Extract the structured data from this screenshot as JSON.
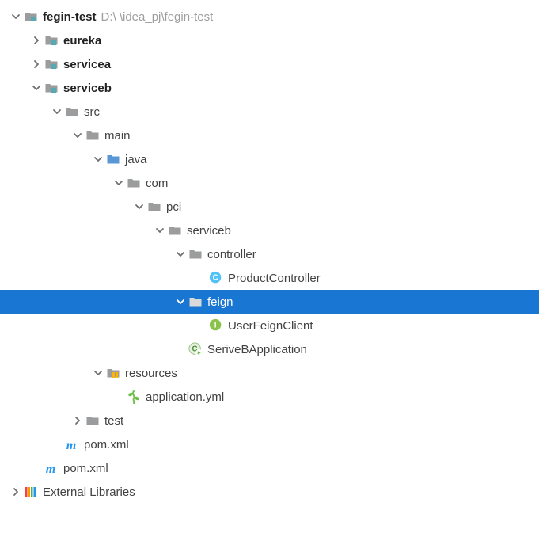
{
  "colors": {
    "selection": "#1976d2",
    "folder_gray": "#9a9c9e",
    "folder_teal": "#59a7b0",
    "folder_source": "#5a96d6",
    "folder_package": "#9a9c9e",
    "class_c": "#4caf50",
    "interface_i": "#8bc34a",
    "spring_run": "#6fbf4a",
    "yml_leaf": "#6fbf4a",
    "maven_m": "#2196f3",
    "lib_bars": [
      "#f44336",
      "#ff9800",
      "#4caf50",
      "#2196f3"
    ]
  },
  "tree": [
    {
      "id": "root",
      "depth": 0,
      "arrow": "down",
      "icon": "module-folder",
      "label": "fegin-test",
      "bold": true,
      "suffix": "D:\\  \\idea_pj\\fegin-test",
      "selected": false
    },
    {
      "id": "eureka",
      "depth": 1,
      "arrow": "right",
      "icon": "module-folder",
      "label": "eureka",
      "bold": true,
      "selected": false
    },
    {
      "id": "servicea",
      "depth": 1,
      "arrow": "right",
      "icon": "module-folder",
      "label": "servicea",
      "bold": true,
      "selected": false
    },
    {
      "id": "serviceb",
      "depth": 1,
      "arrow": "down",
      "icon": "module-folder",
      "label": "serviceb",
      "bold": true,
      "selected": false
    },
    {
      "id": "src",
      "depth": 2,
      "arrow": "down",
      "icon": "folder",
      "label": "src",
      "bold": false,
      "selected": false
    },
    {
      "id": "main",
      "depth": 3,
      "arrow": "down",
      "icon": "folder",
      "label": "main",
      "bold": false,
      "selected": false
    },
    {
      "id": "java",
      "depth": 4,
      "arrow": "down",
      "icon": "source-folder",
      "label": "java",
      "bold": false,
      "selected": false
    },
    {
      "id": "com",
      "depth": 5,
      "arrow": "down",
      "icon": "package-folder",
      "label": "com",
      "bold": false,
      "selected": false
    },
    {
      "id": "pci",
      "depth": 6,
      "arrow": "down",
      "icon": "package-folder",
      "label": "pci",
      "bold": false,
      "selected": false
    },
    {
      "id": "pkg-serviceb",
      "depth": 7,
      "arrow": "down",
      "icon": "package-folder",
      "label": "serviceb",
      "bold": false,
      "selected": false
    },
    {
      "id": "controller",
      "depth": 8,
      "arrow": "down",
      "icon": "package-folder",
      "label": "controller",
      "bold": false,
      "selected": false
    },
    {
      "id": "product-controller",
      "depth": 9,
      "arrow": "none",
      "icon": "class-c",
      "label": "ProductController",
      "bold": false,
      "selected": false
    },
    {
      "id": "feign",
      "depth": 8,
      "arrow": "down",
      "icon": "package-folder",
      "label": "feign",
      "bold": false,
      "selected": true
    },
    {
      "id": "user-feign-client",
      "depth": 9,
      "arrow": "none",
      "icon": "interface-i",
      "label": "UserFeignClient",
      "bold": false,
      "selected": false
    },
    {
      "id": "serviceb-app",
      "depth": 8,
      "arrow": "none",
      "icon": "spring-runnable",
      "label": "SeriveBApplication",
      "bold": false,
      "selected": false
    },
    {
      "id": "resources",
      "depth": 4,
      "arrow": "down",
      "icon": "resources-folder",
      "label": "resources",
      "bold": false,
      "selected": false
    },
    {
      "id": "application-yml",
      "depth": 5,
      "arrow": "none",
      "icon": "yml-file",
      "label": "application.yml",
      "bold": false,
      "selected": false
    },
    {
      "id": "test",
      "depth": 3,
      "arrow": "right",
      "icon": "folder",
      "label": "test",
      "bold": false,
      "selected": false
    },
    {
      "id": "pom-serviceb",
      "depth": 2,
      "arrow": "none",
      "icon": "maven-pom",
      "label": "pom.xml",
      "bold": false,
      "selected": false
    },
    {
      "id": "pom-root",
      "depth": 1,
      "arrow": "none",
      "icon": "maven-pom",
      "label": "pom.xml",
      "bold": false,
      "selected": false
    },
    {
      "id": "external-libraries",
      "depth": 0,
      "arrow": "right",
      "icon": "libraries",
      "label": "External Libraries",
      "bold": false,
      "selected": false
    }
  ]
}
